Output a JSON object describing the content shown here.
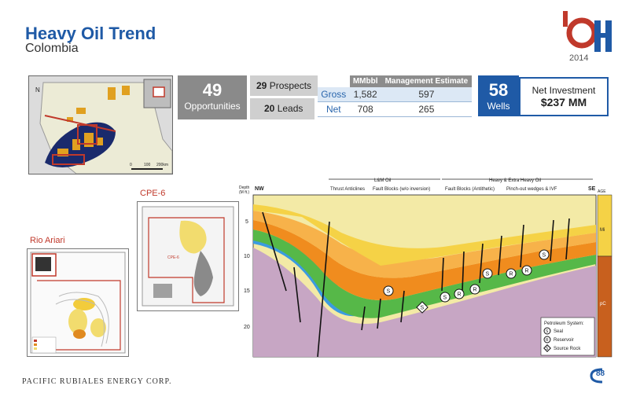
{
  "header": {
    "title": "Heavy Oil Trend",
    "subtitle": "Colombia",
    "logo_year": "2014"
  },
  "opportunities": {
    "count": "49",
    "label": "Opportunities",
    "prospects_count": "29",
    "prospects_label": "Prospects",
    "leads_count": "20",
    "leads_label": "Leads"
  },
  "resource_table": {
    "columns": [
      "MMbbl",
      "Management Estimate"
    ],
    "rows": [
      {
        "label": "Gross",
        "mmbbl": "1,582",
        "estimate": "597"
      },
      {
        "label": "Net",
        "mmbbl": "708",
        "estimate": "265"
      }
    ]
  },
  "wells": {
    "count": "58",
    "label": "Wells"
  },
  "net_investment": {
    "label": "Net Investment",
    "value": "$237 MM"
  },
  "maps": {
    "cpe6_label": "CPE-6",
    "rio_ariari_label": "Rio Ariari",
    "overview_scale": [
      "0",
      "100",
      "200km"
    ]
  },
  "cross_section": {
    "nw_label": "NW",
    "se_label": "SE",
    "depth_label": "Depth",
    "depth_unit": "(M ft.)",
    "depth_ticks": [
      "5",
      "10",
      "15",
      "20"
    ],
    "age_label": "AGE",
    "age_mi": "Mi",
    "age_pc": "pC",
    "group_lm": "L&M Oil",
    "group_heavy": "Heavy & Extra Heavy Oil",
    "zones": [
      "Thrust Anticlines",
      "Fault Blocks (w/o inversion)",
      "Fault Blocks (Antithetic)",
      "Pinch-out wedges & IVF"
    ],
    "legend_title": "Petroleum System:",
    "legend_items": [
      {
        "symbol": "S",
        "label": "Seal"
      },
      {
        "symbol": "R",
        "label": "Reservoir"
      },
      {
        "symbol": "S",
        "label": "Source Rock"
      }
    ]
  },
  "footer": {
    "company": "PACIFIC RUBIALES ENERGY CORP.",
    "page": "88"
  },
  "colors": {
    "brand_blue": "#1f5aa6",
    "brand_red": "#c0392b",
    "stat_grey": "#8a8a8a"
  }
}
